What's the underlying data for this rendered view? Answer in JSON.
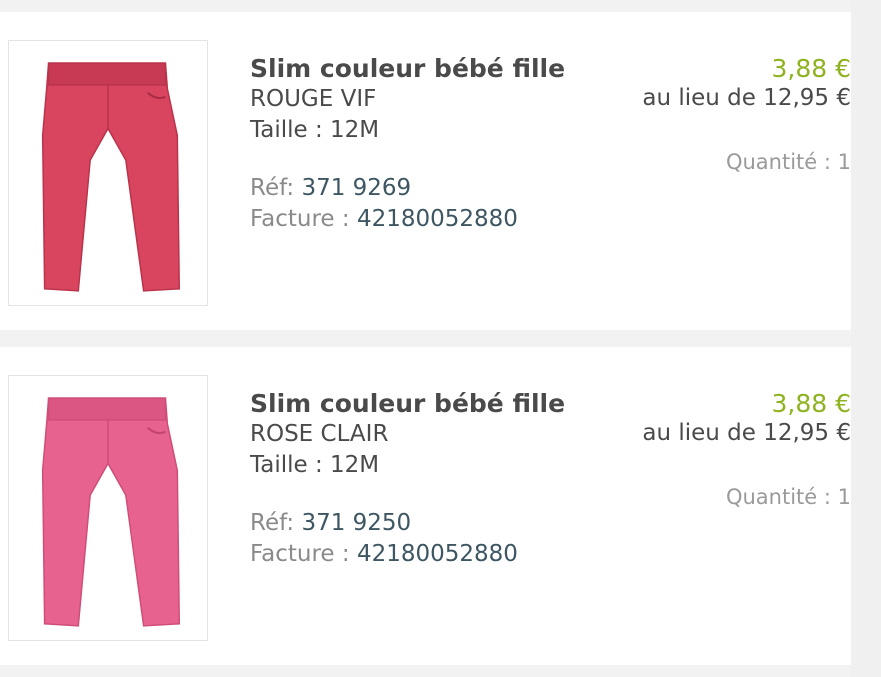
{
  "colors": {
    "price_accent": "#8fb320",
    "text": "#4a4a4a",
    "muted": "#8a8a8a",
    "value_link": "#3d5662",
    "pants_1": "#d9455f",
    "pants_2": "#e8628f"
  },
  "items": [
    {
      "image_icon": "pants-icon",
      "name": "Slim couleur bébé fille",
      "color": "ROUGE VIF",
      "size_label": "Taille : ",
      "size": "12M",
      "ref_label": "Réf: ",
      "ref": "371 9269",
      "invoice_label": "Facture : ",
      "invoice": "42180052880",
      "price": "3,88 €",
      "was_price": "au lieu de 12,95 €",
      "quantity": "Quantité : 1"
    },
    {
      "image_icon": "pants-icon",
      "name": "Slim couleur bébé fille",
      "color": "ROSE CLAIR",
      "size_label": "Taille : ",
      "size": "12M",
      "ref_label": "Réf: ",
      "ref": "371 9250",
      "invoice_label": "Facture : ",
      "invoice": "42180052880",
      "price": "3,88 €",
      "was_price": "au lieu de 12,95 €",
      "quantity": "Quantité : 1"
    }
  ]
}
